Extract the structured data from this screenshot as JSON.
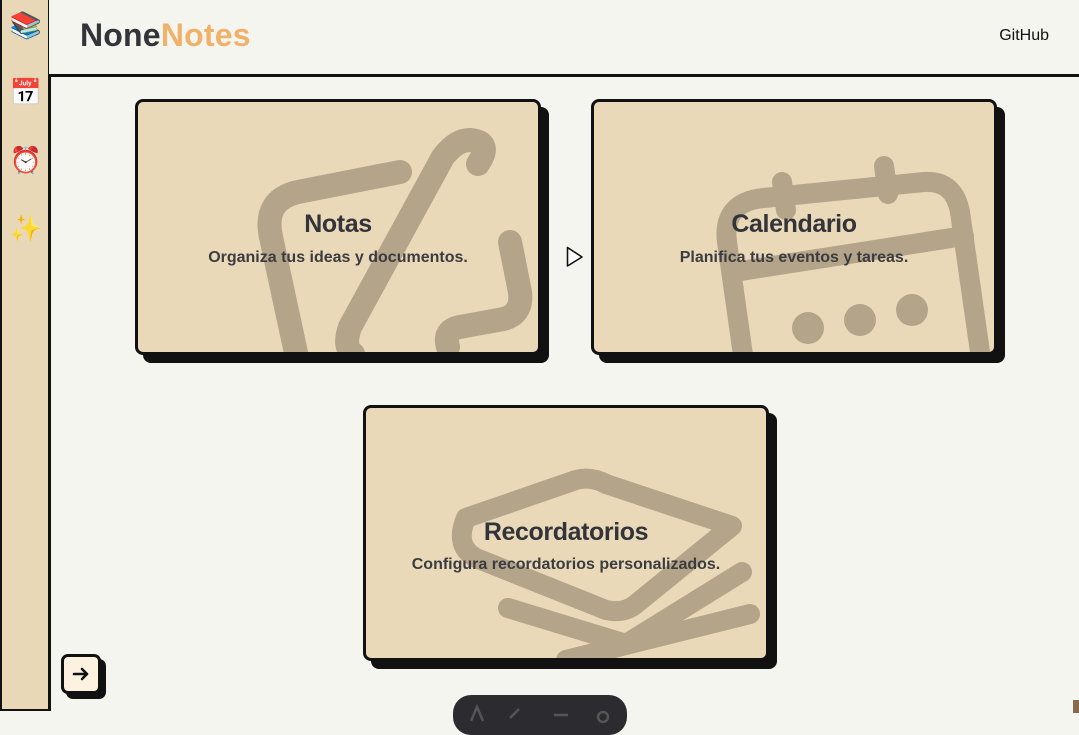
{
  "sidebar": {
    "items": [
      {
        "name": "notes",
        "glyph": "📚"
      },
      {
        "name": "calendar",
        "glyph": "📅"
      },
      {
        "name": "reminders",
        "glyph": "⏰"
      },
      {
        "name": "extras",
        "glyph": "✨"
      }
    ],
    "expand_icon": "arrow-right-icon"
  },
  "header": {
    "logo_part1": "None",
    "logo_part2": "Notes",
    "github_link": "GitHub"
  },
  "cards": [
    {
      "title": "Notas",
      "description": "Organiza tus ideas y documentos.",
      "icon": "edit-note-icon"
    },
    {
      "title": "Calendario",
      "description": "Planifica tus eventos y tareas.",
      "icon": "calendar-icon"
    },
    {
      "title": "Recordatorios",
      "description": "Configura recordatorios personalizados.",
      "icon": "layers-icon"
    }
  ],
  "colors": {
    "background": "#f5f5f0",
    "card": "#e9d9b8",
    "accent": "#f0b26b",
    "text": "#33333a",
    "border": "#111111",
    "icon_watermark": "#b3a48a"
  }
}
